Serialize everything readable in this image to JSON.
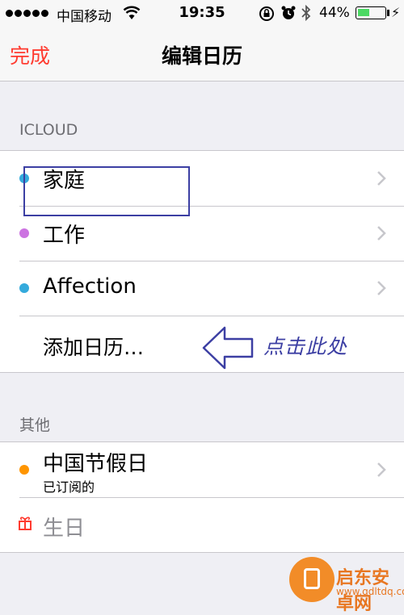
{
  "status_bar": {
    "carrier": "中国移动",
    "time": "19:35",
    "battery_percent": "44%",
    "battery_level": 0.44,
    "icons": [
      "signal-dots-icon",
      "wifi-icon",
      "rotation-lock-icon",
      "alarm-icon",
      "bluetooth-icon",
      "battery-icon",
      "charging-bolt-icon"
    ]
  },
  "nav": {
    "done_label": "完成",
    "title": "编辑日历"
  },
  "icloud": {
    "header": "ICLOUD",
    "items": [
      {
        "label": "家庭",
        "color": "#34aadc"
      },
      {
        "label": "工作",
        "color": "#cc73e1"
      },
      {
        "label": "Affection",
        "color": "#34aadc"
      }
    ],
    "add_label": "添加日历…"
  },
  "annotation": {
    "text": "点击此处",
    "color": "#3c3fa3"
  },
  "other": {
    "header": "其他",
    "holiday": {
      "label": "中国节假日",
      "subtitle": "已订阅的",
      "color": "#ff9500"
    },
    "birthday": {
      "label": "生日",
      "icon": "gift-icon",
      "icon_color": "#ff3b30"
    }
  },
  "colors": {
    "accent": "#ff3b30",
    "background": "#efeff4"
  },
  "watermark": {
    "name": "启东安卓网",
    "url": "www.qdltdq.com"
  }
}
